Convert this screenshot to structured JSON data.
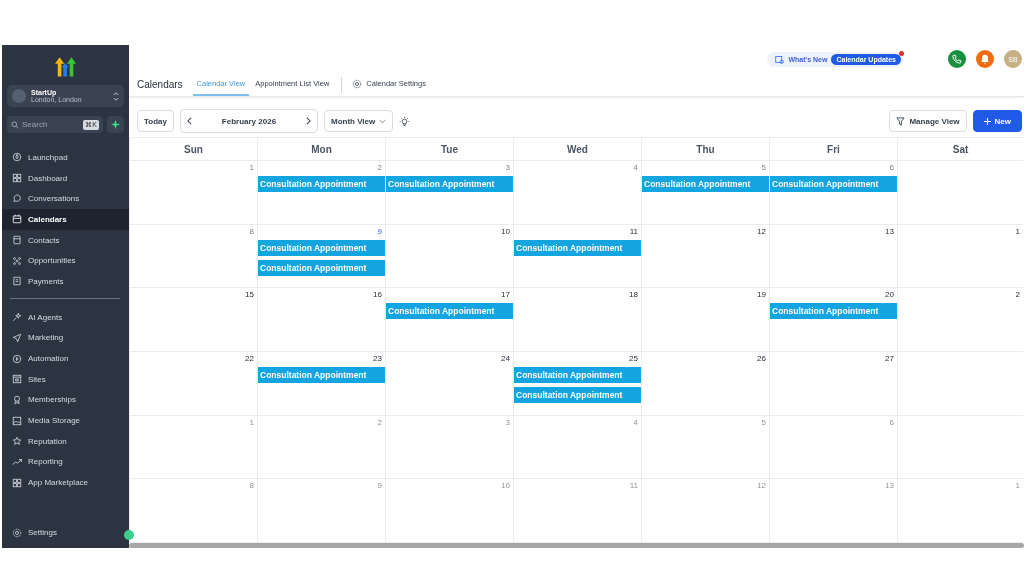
{
  "sidebar": {
    "account": {
      "name": "StartUp",
      "location": "London, London"
    },
    "search": {
      "placeholder": "Search",
      "shortcut": "⌘K"
    },
    "items": [
      {
        "label": "Launchpad",
        "selected": false
      },
      {
        "label": "Dashboard",
        "selected": false
      },
      {
        "label": "Conversations",
        "selected": false
      },
      {
        "label": "Calendars",
        "selected": true
      },
      {
        "label": "Contacts",
        "selected": false
      },
      {
        "label": "Opportunities",
        "selected": false
      },
      {
        "label": "Payments",
        "selected": false
      }
    ],
    "items_2": [
      {
        "label": "AI Agents",
        "selected": false
      },
      {
        "label": "Marketing",
        "selected": false
      },
      {
        "label": "Automation",
        "selected": false
      },
      {
        "label": "Sites",
        "selected": false
      },
      {
        "label": "Memberships",
        "selected": false
      },
      {
        "label": "Media Storage",
        "selected": false
      },
      {
        "label": "Reputation",
        "selected": false
      },
      {
        "label": "Reporting",
        "selected": false
      },
      {
        "label": "App Marketplace",
        "selected": false
      }
    ],
    "footer": {
      "label": "Settings",
      "selected": false
    }
  },
  "topbar": {
    "whats_new": "What's New",
    "updates_badge": "Calendar Updates",
    "avatar": "SB"
  },
  "header": {
    "title": "Calendars",
    "tabs": [
      {
        "label": "Calendar View",
        "selected": true
      },
      {
        "label": "Appointment List View",
        "selected": false
      }
    ],
    "settings": "Calendar Settings"
  },
  "toolbar": {
    "today": "Today",
    "month": "February 2026",
    "view": "Month View",
    "manage": "Manage View",
    "new": "New"
  },
  "calendar": {
    "weekdays": [
      "Sun",
      "Mon",
      "Tue",
      "Wed",
      "Thu",
      "Fri",
      "Sat"
    ],
    "weeks": [
      {
        "days": [
          {
            "date": "1",
            "kind": "past"
          },
          {
            "date": "2",
            "kind": "past",
            "events": [
              "Consultation Appointment"
            ]
          },
          {
            "date": "3",
            "kind": "past",
            "events": [
              "Consultation Appointment"
            ]
          },
          {
            "date": "4",
            "kind": "past"
          },
          {
            "date": "5",
            "kind": "past",
            "events": [
              "Consultation Appointment"
            ]
          },
          {
            "date": "6",
            "kind": "past",
            "events": [
              "Consultation Appointment"
            ]
          }
        ]
      },
      {
        "days": [
          {
            "date": "8",
            "kind": "past"
          },
          {
            "date": "9",
            "kind": "today",
            "events": [
              "Consultation Appointment",
              "Consultation Appointment"
            ]
          },
          {
            "date": "10",
            "kind": "upcoming"
          },
          {
            "date": "11",
            "kind": "upcoming",
            "events": [
              "Consultation Appointment"
            ]
          },
          {
            "date": "12",
            "kind": "upcoming"
          },
          {
            "date": "13",
            "kind": "upcoming"
          },
          {
            "date": "1",
            "kind": "upcoming"
          }
        ]
      },
      {
        "days": [
          {
            "date": "15",
            "kind": "upcoming"
          },
          {
            "date": "16",
            "kind": "upcoming"
          },
          {
            "date": "17",
            "kind": "upcoming",
            "events": [
              "Consultation Appointment"
            ]
          },
          {
            "date": "18",
            "kind": "upcoming"
          },
          {
            "date": "19",
            "kind": "upcoming"
          },
          {
            "date": "20",
            "kind": "upcoming",
            "events": [
              "Consultation Appointment"
            ]
          },
          {
            "date": "2",
            "kind": "upcoming"
          }
        ]
      },
      {
        "days": [
          {
            "date": "22",
            "kind": "upcoming"
          },
          {
            "date": "23",
            "kind": "upcoming",
            "events": [
              "Consultation Appointment"
            ]
          },
          {
            "date": "24",
            "kind": "upcoming"
          },
          {
            "date": "25",
            "kind": "upcoming",
            "events": [
              "Consultation Appointment",
              "Consultation Appointment"
            ]
          },
          {
            "date": "26",
            "kind": "upcoming"
          },
          {
            "date": "27",
            "kind": "upcoming"
          }
        ]
      },
      {
        "days": [
          {
            "date": "1",
            "kind": "outside"
          },
          {
            "date": "2",
            "kind": "outside"
          },
          {
            "date": "3",
            "kind": "outside"
          },
          {
            "date": "4",
            "kind": "outside"
          },
          {
            "date": "5",
            "kind": "outside"
          },
          {
            "date": "6",
            "kind": "outside"
          }
        ]
      },
      {
        "days": [
          {
            "date": "8",
            "kind": "outside"
          },
          {
            "date": "9",
            "kind": "outside"
          },
          {
            "date": "10",
            "kind": "outside"
          },
          {
            "date": "11",
            "kind": "outside"
          },
          {
            "date": "12",
            "kind": "outside"
          },
          {
            "date": "13",
            "kind": "outside"
          },
          {
            "date": "1",
            "kind": "outside"
          }
        ]
      }
    ]
  }
}
